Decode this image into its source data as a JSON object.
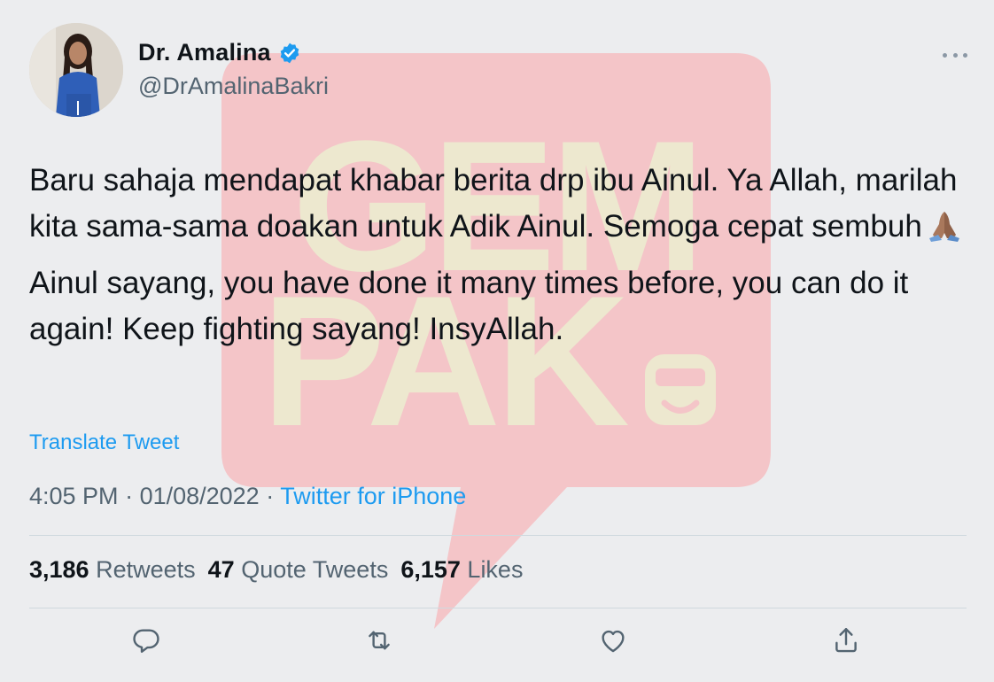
{
  "tweet": {
    "display_name": "Dr. Amalina",
    "handle": "@DrAmalinaBakri",
    "body_line_1": "Baru sahaja mendapat khabar berita drp ibu Ainul. Ya Allah, marilah kita sama-sama doakan untuk Adik Ainul. Semoga cepat sembuh",
    "body_line_2": "Ainul sayang, you have done it many times before, you can do it again! Keep fighting sayang! InsyAllah.",
    "translate_label": "Translate Tweet",
    "time": "4:05 PM",
    "date": "01/08/2022",
    "source": "Twitter for iPhone",
    "separator": " · "
  },
  "stats": {
    "retweets_count": "3,186",
    "retweets_label": "Retweets",
    "quotes_count": "47",
    "quotes_label": "Quote Tweets",
    "likes_count": "6,157",
    "likes_label": "Likes"
  },
  "watermark": {
    "line1": "GEM",
    "line2": "PAK"
  },
  "icons": {
    "verified": "verified-badge-icon",
    "more": "more-options-icon",
    "emoji": "folded-hands-emoji",
    "reply": "reply-icon",
    "retweet": "retweet-icon",
    "like": "like-icon",
    "share": "share-icon"
  },
  "colors": {
    "link": "#1d9bf0",
    "secondary": "#536471",
    "watermark_red": "#f4c5c8",
    "watermark_yellow": "#ede8cf"
  }
}
